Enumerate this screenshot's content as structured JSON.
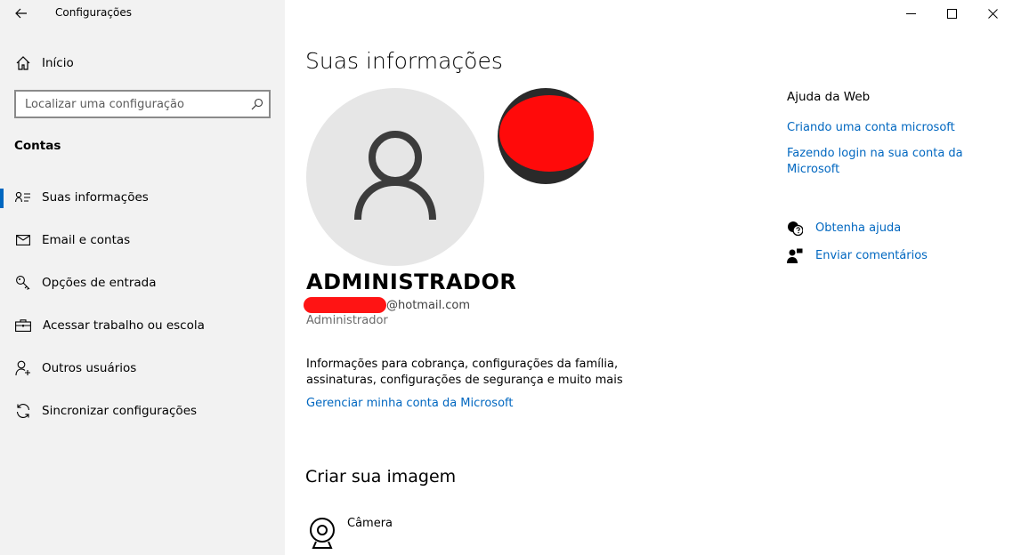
{
  "window": {
    "app_title": "Configurações",
    "controls": [
      "minimize",
      "maximize",
      "close"
    ]
  },
  "sidebar": {
    "home_label": "Início",
    "search_placeholder": "Localizar uma configuração",
    "section_title": "Contas",
    "items": [
      {
        "label": "Suas informações",
        "icon": "person-card-icon",
        "active": true
      },
      {
        "label": "Email e contas",
        "icon": "mail-icon",
        "active": false
      },
      {
        "label": "Opções de entrada",
        "icon": "key-icon",
        "active": false
      },
      {
        "label": "Acessar trabalho ou escola",
        "icon": "briefcase-icon",
        "active": false
      },
      {
        "label": "Outros usuários",
        "icon": "add-person-icon",
        "active": false
      },
      {
        "label": "Sincronizar configurações",
        "icon": "sync-icon",
        "active": false
      }
    ]
  },
  "main": {
    "page_title": "Suas informações",
    "user_name": "ADMINISTRADOR",
    "email_domain": "@hotmail.com",
    "role": "Administrador",
    "info_text": "Informações para cobrança, configurações da família, assinaturas, configurações de segurança e muito mais",
    "manage_link": "Gerenciar minha conta da Microsoft",
    "create_title": "Criar sua imagem",
    "camera_label": "Câmera"
  },
  "help": {
    "title": "Ajuda da Web",
    "links": [
      "Criando uma conta microsoft",
      "Fazendo login na sua conta da Microsoft"
    ],
    "get_help": "Obtenha ajuda",
    "feedback": "Enviar comentários"
  },
  "colors": {
    "accent": "#0067c0",
    "sidebar_bg": "#f2f2f2",
    "redaction": "#ff1414"
  }
}
